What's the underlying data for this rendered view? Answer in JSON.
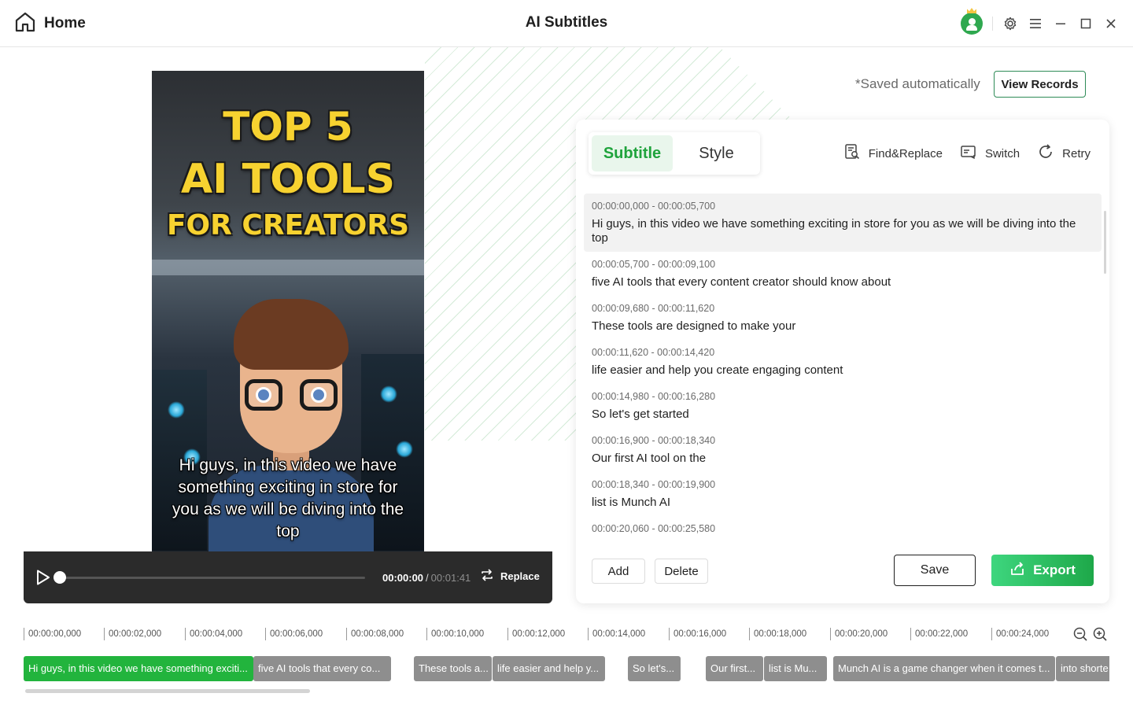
{
  "header": {
    "home_label": "Home",
    "title": "AI Subtitles",
    "icons": [
      "home-icon",
      "avatar",
      "settings-icon",
      "menu-icon",
      "minimize-icon",
      "maximize-icon",
      "close-icon"
    ]
  },
  "video": {
    "title_line1": "TOP 5",
    "title_line2": "AI TOOLS",
    "title_line3": "FOR CREATORS",
    "subtitle": "Hi guys, in this video we have something exciting in store for you as we will be diving into the top"
  },
  "player": {
    "current_time": "00:00:00",
    "separator": "/",
    "duration": "00:01:41",
    "progress": 0,
    "replace_label": "Replace"
  },
  "status": {
    "saved_text": "*Saved automatically",
    "view_records_label": "View Records"
  },
  "panel": {
    "tabs": [
      {
        "label": "Subtitle",
        "active": true
      },
      {
        "label": "Style",
        "active": false
      }
    ],
    "tools": {
      "find_replace": "Find&Replace",
      "switch": "Switch",
      "retry": "Retry"
    },
    "entries": [
      {
        "time": "00:00:00,000 - 00:00:05,700",
        "text": "Hi guys, in this video we have something exciting in store for you as we will be diving into the top"
      },
      {
        "time": "00:00:05,700 - 00:00:09,100",
        "text": "five AI tools that every content creator should know about"
      },
      {
        "time": "00:00:09,680 - 00:00:11,620",
        "text": "These tools are designed to make your"
      },
      {
        "time": "00:00:11,620 - 00:00:14,420",
        "text": "life easier and help you create engaging content"
      },
      {
        "time": "00:00:14,980 - 00:00:16,280",
        "text": "So let's get started"
      },
      {
        "time": "00:00:16,900 - 00:00:18,340",
        "text": "Our first AI tool on the"
      },
      {
        "time": "00:00:18,340 - 00:00:19,900",
        "text": "list is Munch AI"
      },
      {
        "time": "00:00:20,060 - 00:00:25,580",
        "text": ""
      }
    ],
    "buttons": {
      "add": "Add",
      "delete": "Delete",
      "save": "Save",
      "export": "Export"
    }
  },
  "timeline": {
    "ticks": [
      "00:00:00,000",
      "00:00:02,000",
      "00:00:04,000",
      "00:00:06,000",
      "00:00:08,000",
      "00:00:10,000",
      "00:00:12,000",
      "00:00:14,000",
      "00:00:16,000",
      "00:00:18,000",
      "00:00:20,000",
      "00:00:22,000",
      "00:00:24,000"
    ],
    "clips": [
      {
        "text": "Hi guys, in this video we have something exciti...",
        "active": true
      },
      {
        "text": "five AI tools that every co...",
        "active": false
      },
      {
        "text": "These tools a...",
        "active": false
      },
      {
        "text": "life easier and help y...",
        "active": false
      },
      {
        "text": "So let's...",
        "active": false
      },
      {
        "text": "Our first...",
        "active": false
      },
      {
        "text": "list is Mu...",
        "active": false
      },
      {
        "text": "Munch AI is a game changer when it comes t...",
        "active": false
      },
      {
        "text": "into shorte",
        "active": false
      }
    ]
  },
  "colors": {
    "accent_green": "#22b43d",
    "export_gradient_start": "#3ed67e",
    "export_gradient_end": "#1ea849",
    "clip_gray": "#8e8e8e",
    "video_title_yellow": "#f7d230"
  }
}
